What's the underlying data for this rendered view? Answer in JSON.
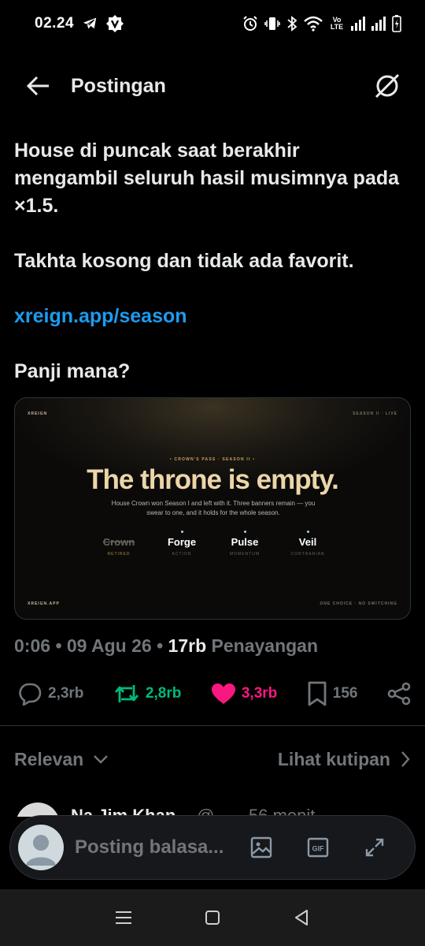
{
  "status_bar": {
    "time": "02.24",
    "lte_top": "Vo",
    "lte_bottom": "LTE"
  },
  "header": {
    "title": "Postingan"
  },
  "post": {
    "line1": "House di puncak saat berakhir mengambil seluruh hasil musimnya pada ×1.5.",
    "line2": "Takhta kosong dan tidak ada favorit.",
    "link": "xreign.app/season",
    "line3": "Panji mana?"
  },
  "media": {
    "brand_top_left": "XREIGN",
    "top_right": "SEASON II · LIVE",
    "kicker": "• CROWN'S PASS · SEASON II •",
    "headline": "The throne is empty.",
    "subtext": "House Crown won Season I and left with it. Three banners remain — you swear to one, and it holds for the whole season.",
    "banners": [
      {
        "name": "Crown",
        "desc": "RETIRED"
      },
      {
        "name": "Forge",
        "desc": "ACTION"
      },
      {
        "name": "Pulse",
        "desc": "MOMENTUM"
      },
      {
        "name": "Veil",
        "desc": "CONTRARIAN"
      }
    ],
    "bottom_left": "XREIGN.APP",
    "bottom_right": "ONE CHOICE · NO SWITCHING"
  },
  "meta": {
    "time": "0:06",
    "date": "09 Agu 26",
    "views_count": "17rb",
    "views_label": "Penayangan"
  },
  "actions": {
    "replies": "2,3rb",
    "reposts": "2,8rb",
    "likes": "3,3rb",
    "bookmarks": "156"
  },
  "colors": {
    "accent_blue": "#1d9bf0",
    "repost_green": "#00ba7c",
    "like_pink": "#f91880",
    "muted": "#71767b"
  },
  "sort": {
    "left": "Relevan",
    "right": "Lihat kutipan"
  },
  "reply_preview": {
    "name": "Na Jim Khan",
    "handle": "@",
    "time": "56 menit"
  },
  "composer": {
    "placeholder": "Posting balasa..."
  },
  "icons": [
    "telegram-icon",
    "vpn-icon",
    "alarm-icon",
    "vibrate-icon",
    "bluetooth-icon",
    "wifi-icon",
    "signal-icon",
    "battery-icon",
    "back-arrow-icon",
    "grok-icon",
    "reply-icon",
    "repost-icon",
    "heart-icon",
    "bookmark-icon",
    "share-icon",
    "chevron-down-icon",
    "chevron-right-icon",
    "image-icon",
    "gif-icon",
    "expand-icon",
    "recents-icon",
    "home-icon",
    "back-nav-icon"
  ]
}
